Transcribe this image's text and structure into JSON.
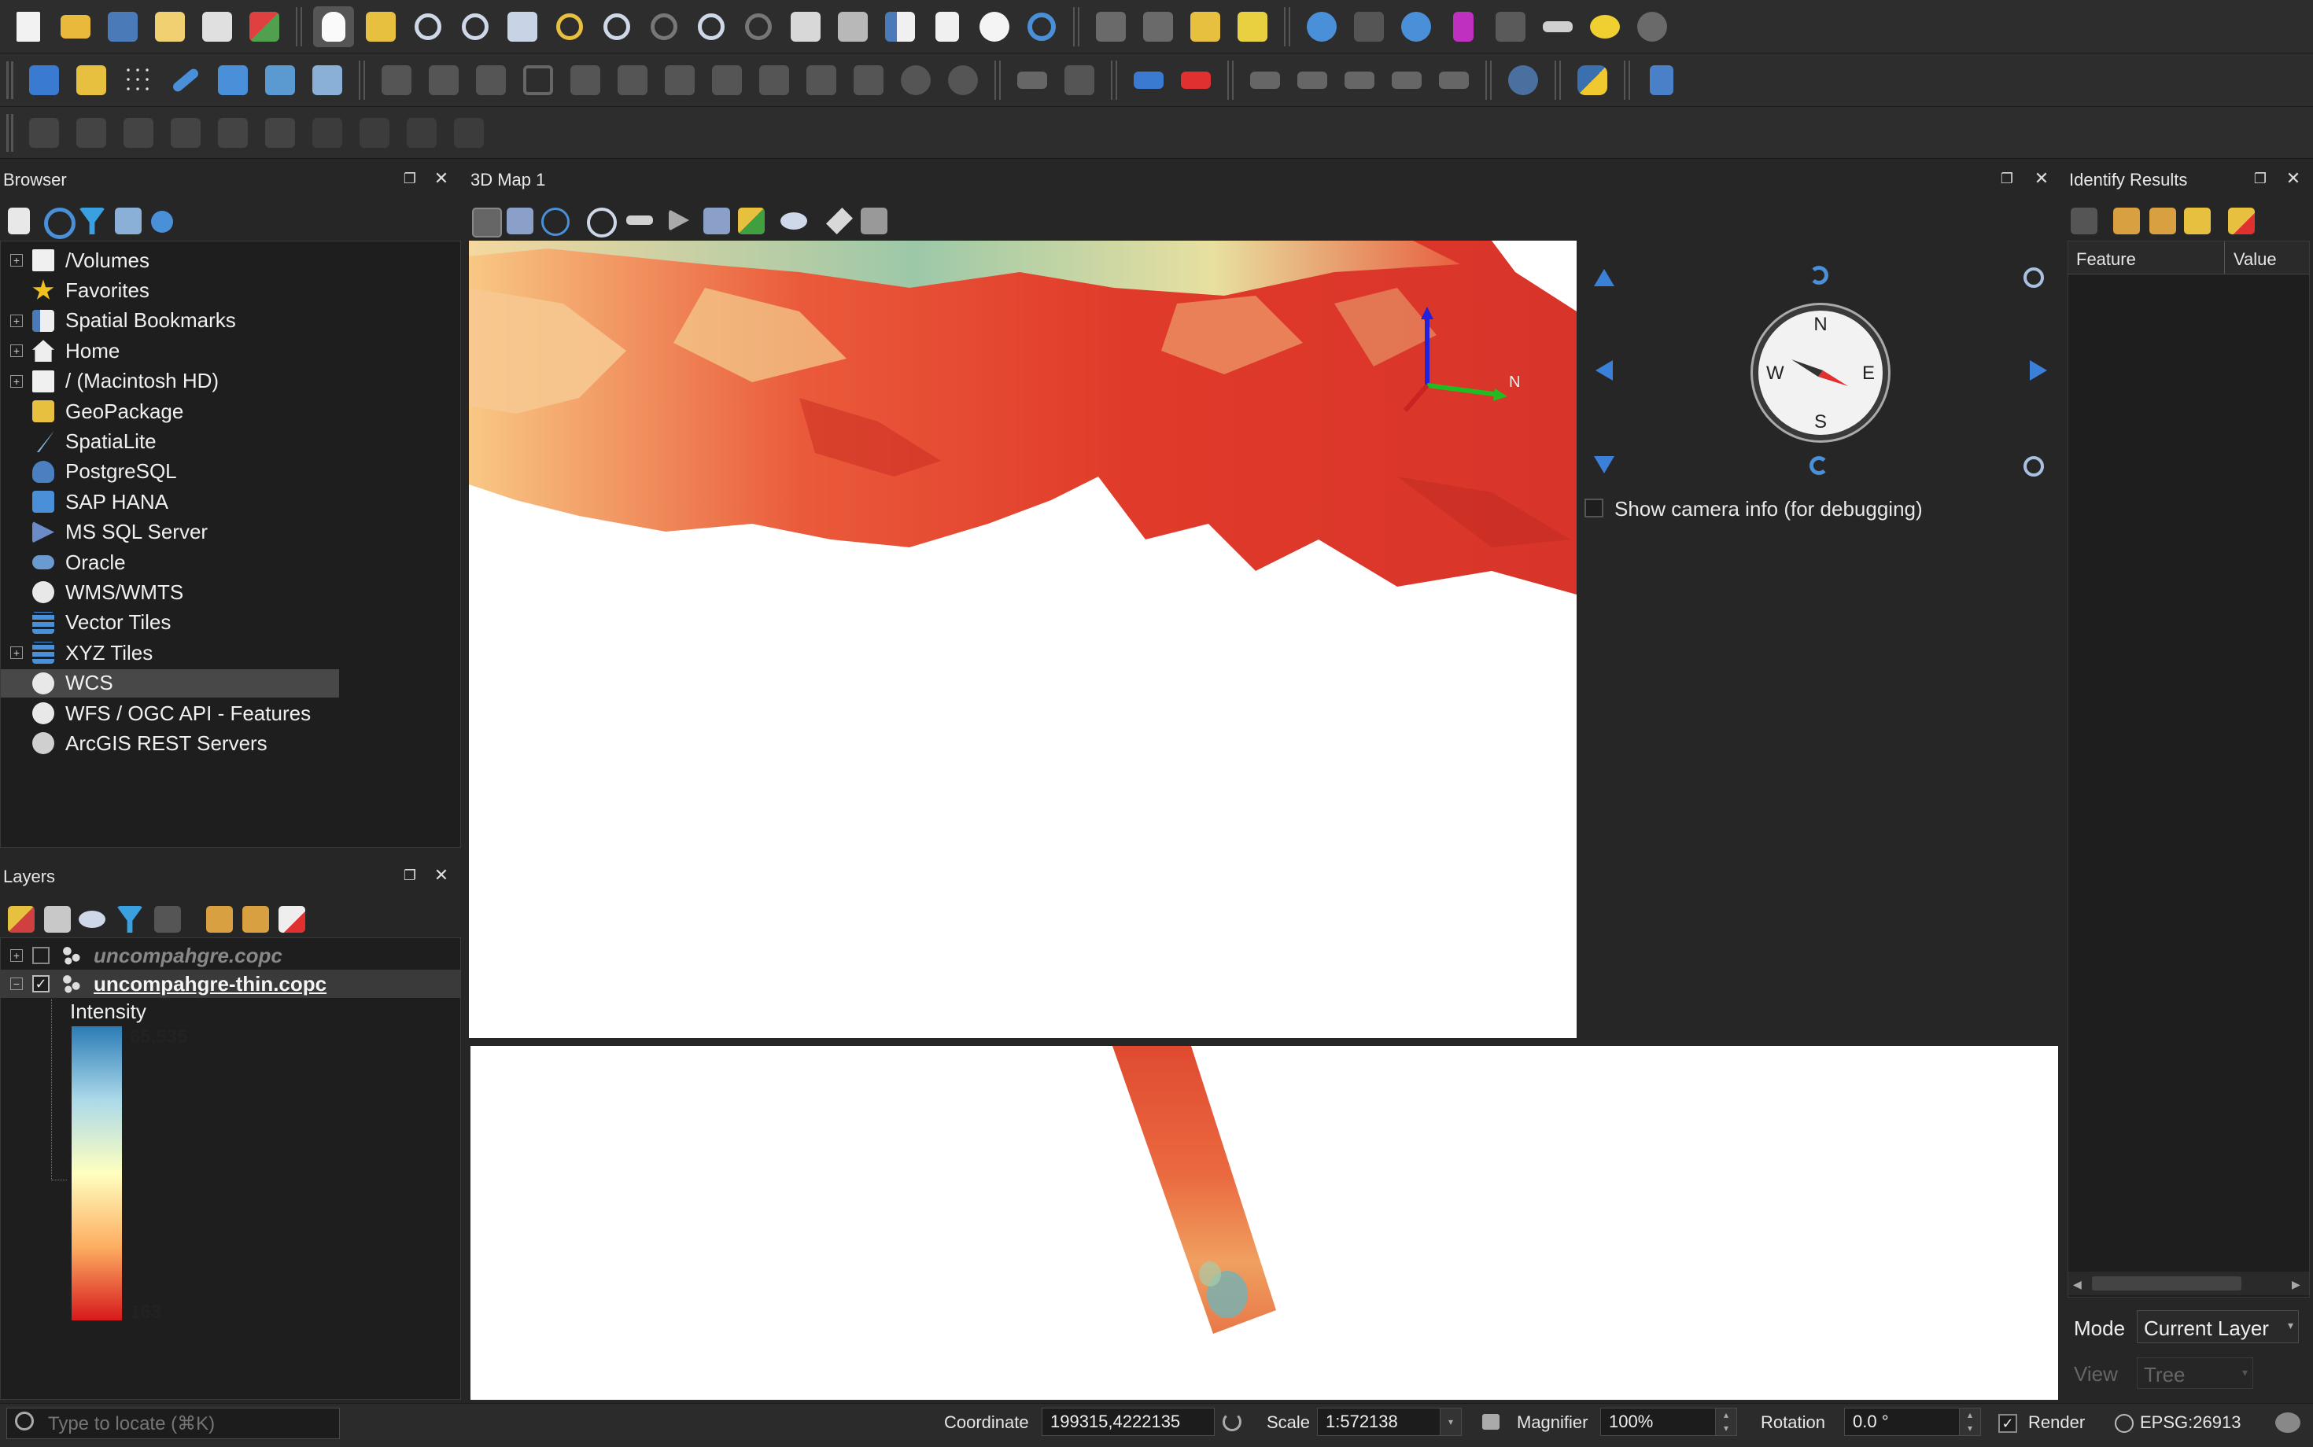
{
  "browser": {
    "title": "Browser",
    "items": [
      {
        "label": "/Volumes",
        "icon": "folder-icon",
        "expandable": true
      },
      {
        "label": "Favorites",
        "icon": "star-icon",
        "expandable": false
      },
      {
        "label": "Spatial Bookmarks",
        "icon": "bookmark-icon",
        "expandable": true
      },
      {
        "label": "Home",
        "icon": "home-icon",
        "expandable": true
      },
      {
        "label": "/ (Macintosh HD)",
        "icon": "folder-icon",
        "expandable": true
      },
      {
        "label": "GeoPackage",
        "icon": "geopackage-icon",
        "expandable": false
      },
      {
        "label": "SpatiaLite",
        "icon": "spatialite-icon",
        "expandable": false
      },
      {
        "label": "PostgreSQL",
        "icon": "postgresql-icon",
        "expandable": false
      },
      {
        "label": "SAP HANA",
        "icon": "sap-hana-icon",
        "expandable": false
      },
      {
        "label": "MS SQL Server",
        "icon": "mssql-icon",
        "expandable": false
      },
      {
        "label": "Oracle",
        "icon": "oracle-icon",
        "expandable": false
      },
      {
        "label": "WMS/WMTS",
        "icon": "globe-icon",
        "expandable": false
      },
      {
        "label": "Vector Tiles",
        "icon": "grid-icon",
        "expandable": false
      },
      {
        "label": "XYZ Tiles",
        "icon": "grid-icon",
        "expandable": true
      },
      {
        "label": "WCS",
        "icon": "globe-icon",
        "expandable": false,
        "selected": true
      },
      {
        "label": "WFS / OGC API - Features",
        "icon": "globe-icon",
        "expandable": false
      },
      {
        "label": "ArcGIS REST Servers",
        "icon": "arcgis-icon",
        "expandable": false
      }
    ]
  },
  "layers": {
    "title": "Layers",
    "items": [
      {
        "label": "uncompahgre.copc",
        "checked": false
      },
      {
        "label": "uncompahgre-thin.copc",
        "checked": true
      }
    ],
    "legend": {
      "title": "Intensity",
      "max": "65,535",
      "min": "163"
    }
  },
  "map3d": {
    "title": "3D Map 1",
    "compass": {
      "n": "N",
      "e": "E",
      "s": "S",
      "w": "W"
    },
    "camera_info_label": "Show camera info (for debugging)",
    "camera_info_checked": false,
    "axis_label": "N"
  },
  "identify": {
    "title": "Identify Results",
    "col_feature": "Feature",
    "col_value": "Value",
    "mode_label": "Mode",
    "mode_value": "Current Layer",
    "view_label": "View",
    "view_value": "Tree"
  },
  "status": {
    "locator_placeholder": "Type to locate (⌘K)",
    "coordinate_label": "Coordinate",
    "coordinate_value": "199315,4222135",
    "scale_label": "Scale",
    "scale_value": "1:572138",
    "magnifier_label": "Magnifier",
    "magnifier_value": "100%",
    "rotation_label": "Rotation",
    "rotation_value": "0.0 °",
    "render_label": "Render",
    "render_checked": true,
    "crs": "EPSG:26913"
  },
  "colors": {
    "accent_blue": "#2f7fd8",
    "ramp_high": "#2c7bb6",
    "ramp_low": "#d7191c"
  }
}
